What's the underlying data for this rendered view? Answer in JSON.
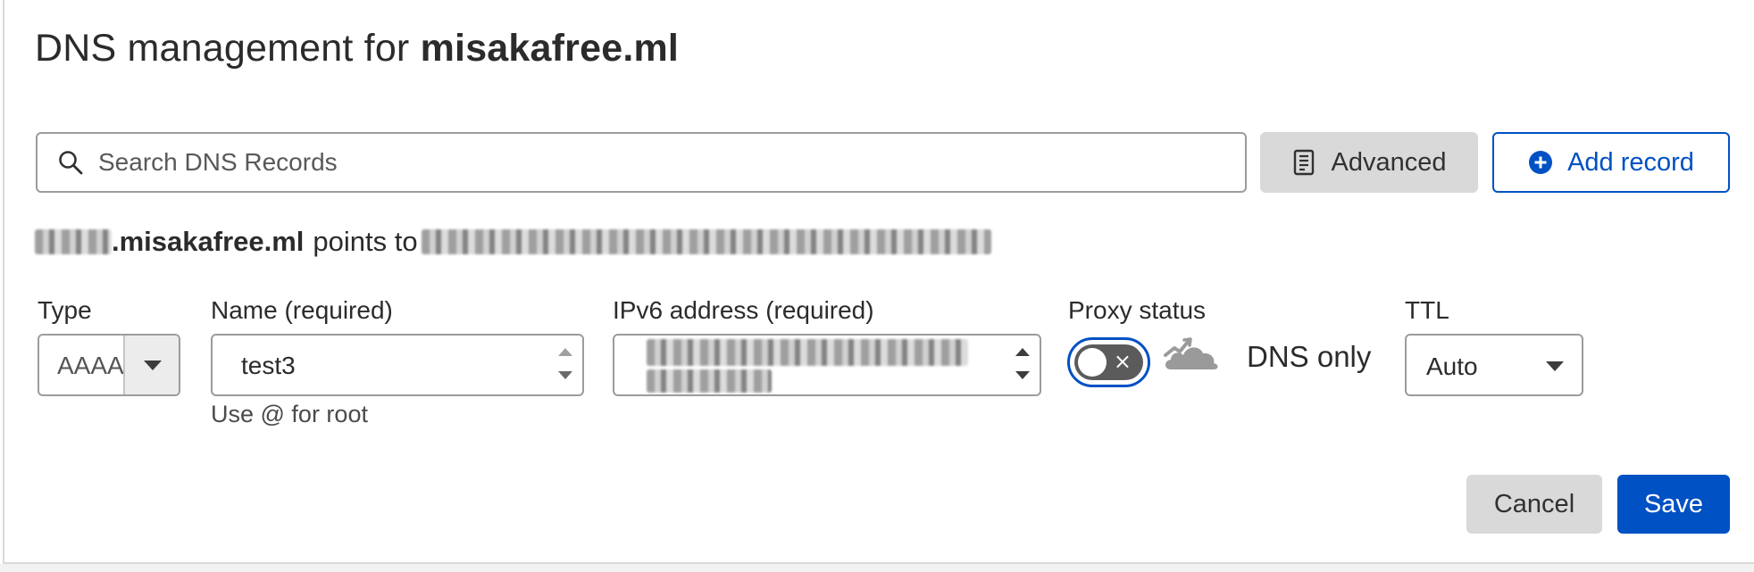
{
  "header": {
    "title_prefix": "DNS management for ",
    "title_domain": "misakafree.ml"
  },
  "toolbar": {
    "search_placeholder": "Search DNS Records",
    "search_icon": "magnifier-icon",
    "advanced_label": "Advanced",
    "advanced_icon": "document-list-icon",
    "add_record_label": "Add record",
    "add_record_icon": "plus-circle-icon"
  },
  "preview": {
    "domain": ".misakafree.ml",
    "points_to": "points to"
  },
  "form": {
    "type_label": "Type",
    "type_value": "AAAA",
    "name_label": "Name (required)",
    "name_value": "test3",
    "name_helper": "Use @ for root",
    "ipv6_label": "IPv6 address (required)",
    "proxy_label": "Proxy status",
    "proxy_enabled": false,
    "proxy_toggle_glyph": "×",
    "proxy_icon": "cloud-bypass-icon",
    "proxy_text": "DNS only",
    "ttl_label": "TTL",
    "ttl_value": "Auto"
  },
  "actions": {
    "cancel_label": "Cancel",
    "save_label": "Save"
  },
  "colors": {
    "primary": "#0051c3",
    "secondary_button": "#d9d9d9",
    "toggle_off": "#5b5b5b",
    "cloud_gray": "#9a9a9a"
  }
}
